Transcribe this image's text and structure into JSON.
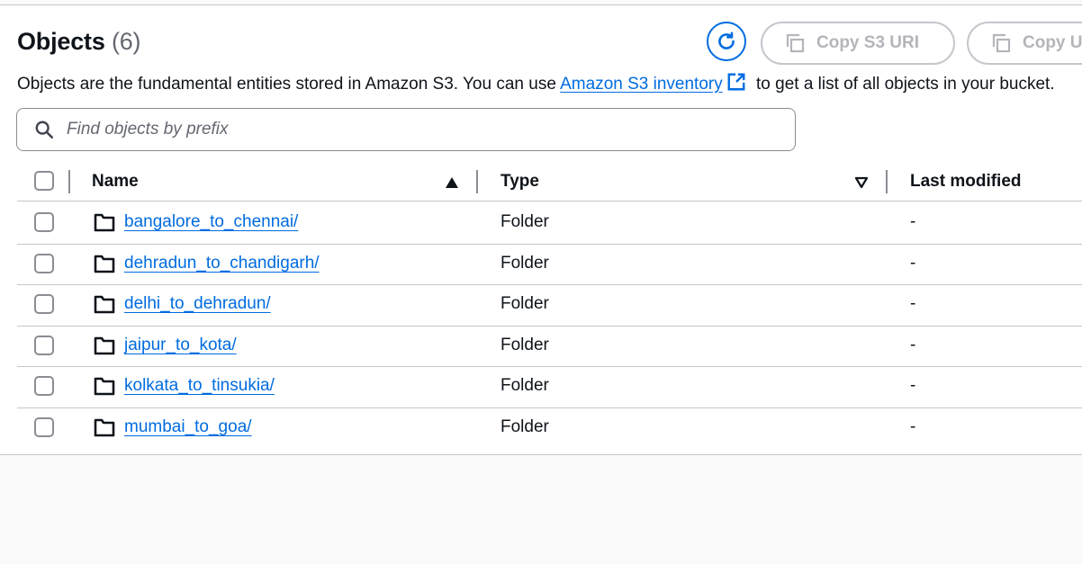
{
  "header": {
    "title": "Objects",
    "count": "(6)",
    "refresh_icon": "refresh-icon",
    "copy_s3_uri_label": "Copy S3 URI",
    "copy_url_label": "Copy URL",
    "copy_icon": "copy-icon"
  },
  "description": {
    "text_before": "Objects are the fundamental entities stored in Amazon S3. You can use ",
    "link": "Amazon S3 inventory",
    "text_after": " to get a list of all objects in your bucket."
  },
  "search": {
    "placeholder": "Find objects by prefix",
    "value": ""
  },
  "table": {
    "columns": {
      "name": "Name",
      "type": "Type",
      "last_modified": "Last modified"
    },
    "rows": [
      {
        "name": "bangalore_to_chennai/",
        "type": "Folder",
        "last_modified": "-"
      },
      {
        "name": "dehradun_to_chandigarh/",
        "type": "Folder",
        "last_modified": "-"
      },
      {
        "name": "delhi_to_dehradun/",
        "type": "Folder",
        "last_modified": "-"
      },
      {
        "name": "jaipur_to_kota/",
        "type": "Folder",
        "last_modified": "-"
      },
      {
        "name": "kolkata_to_tinsukia/",
        "type": "Folder",
        "last_modified": "-"
      },
      {
        "name": "mumbai_to_goa/",
        "type": "Folder",
        "last_modified": "-"
      }
    ]
  },
  "colors": {
    "link": "#006ce0",
    "border": "#c6c6cd",
    "disabled_text": "#b4b4bb"
  }
}
